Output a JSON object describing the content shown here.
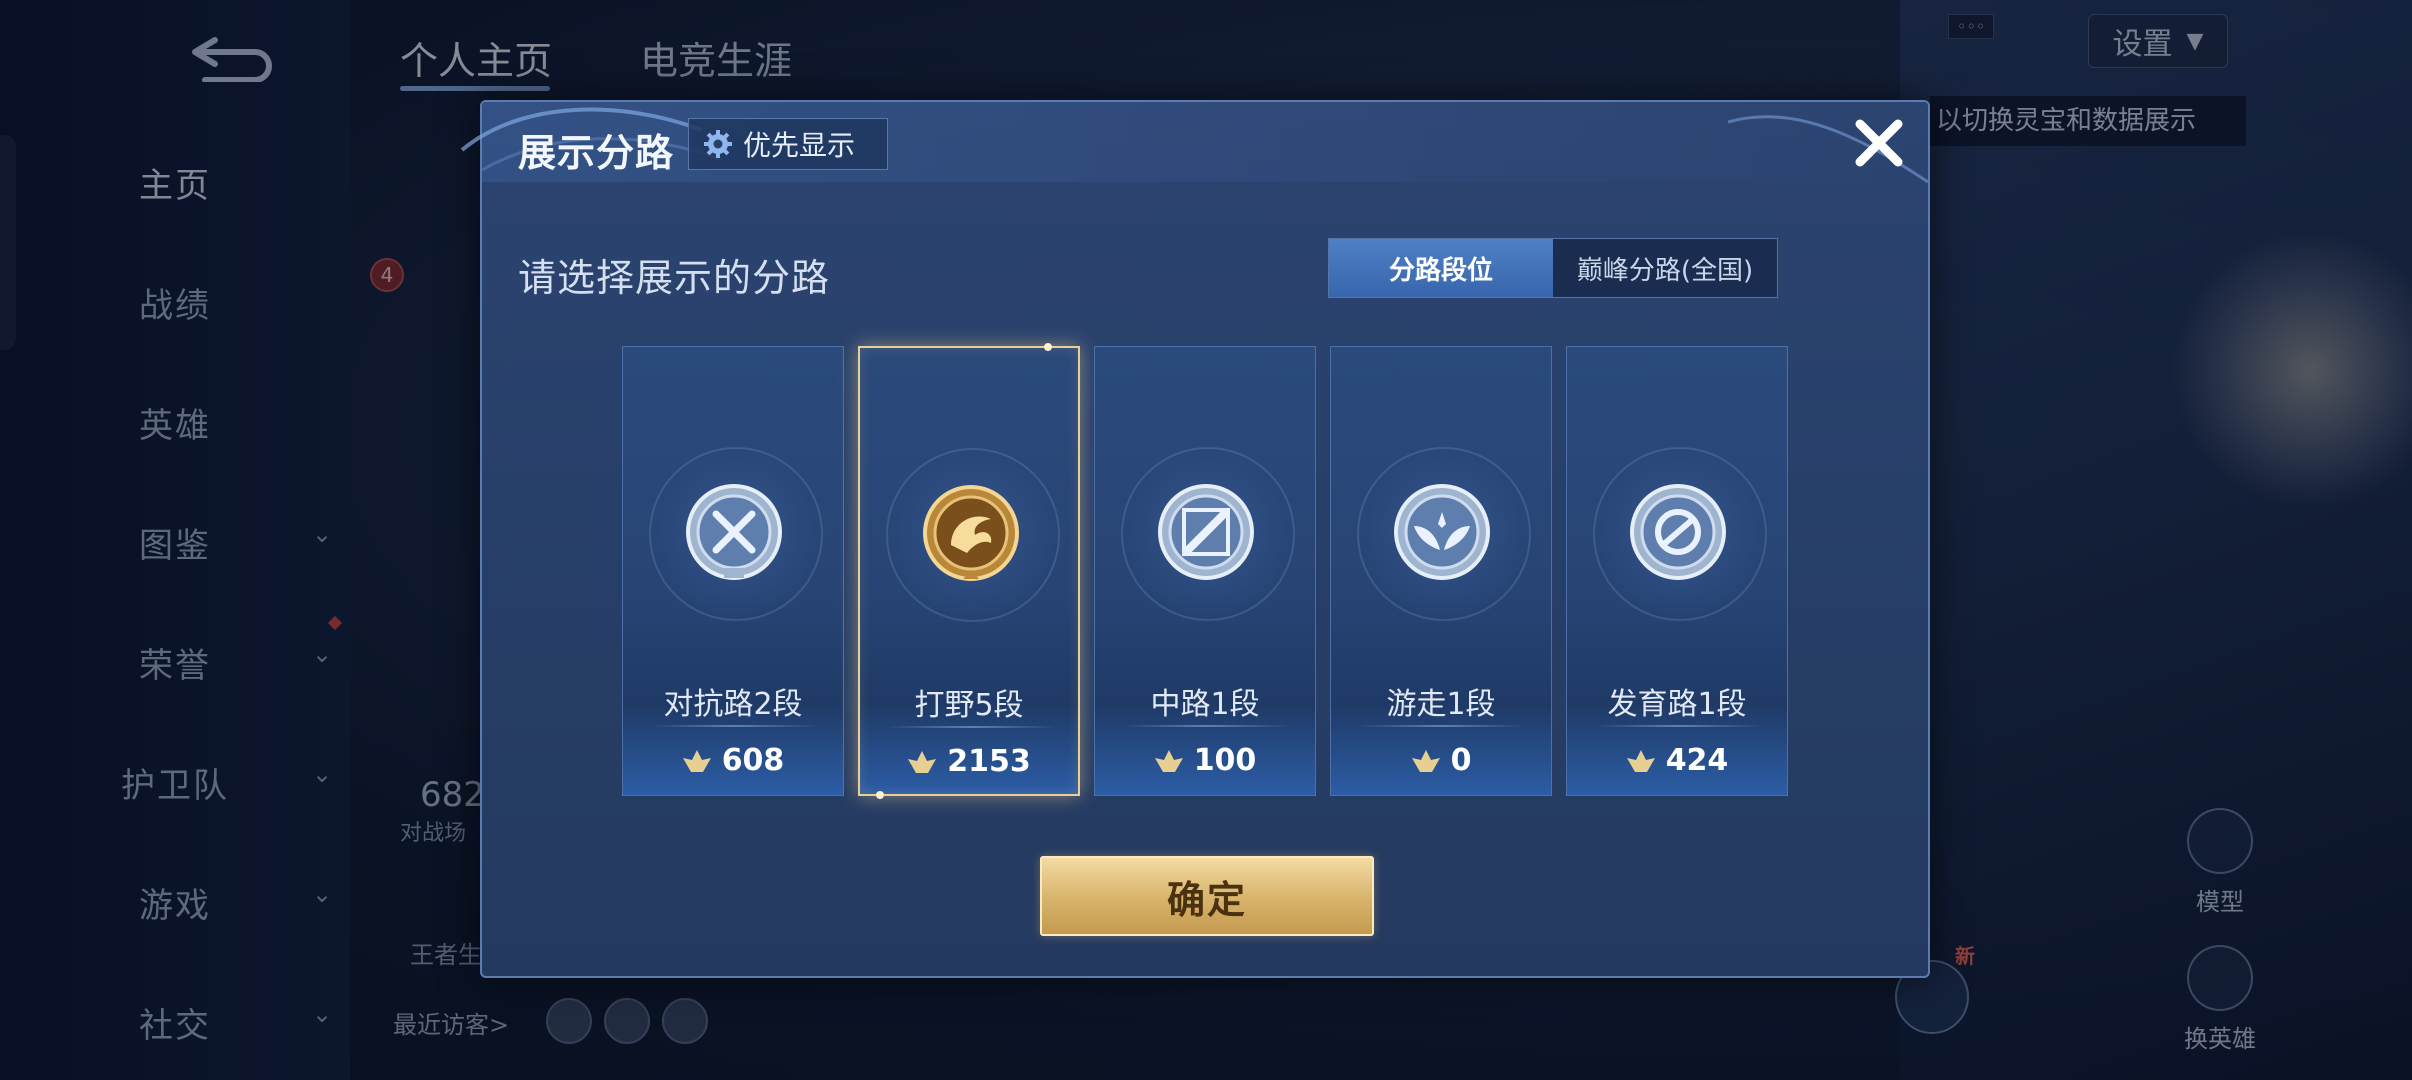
{
  "background": {
    "tabs": [
      {
        "label": "个人主页",
        "active": true
      },
      {
        "label": "电竞生涯",
        "active": false
      }
    ],
    "sidebar": {
      "items": [
        {
          "label": "主页",
          "active": true
        },
        {
          "label": "战绩"
        },
        {
          "label": "英雄"
        },
        {
          "label": "图鉴",
          "chevron": "⌄"
        },
        {
          "label": "荣誉",
          "chevron": "⌄"
        },
        {
          "label": "护卫队",
          "chevron": "⌄"
        },
        {
          "label": "游戏",
          "chevron": "⌄"
        },
        {
          "label": "社交",
          "chevron": "⌄"
        }
      ]
    },
    "settings_label": "设置",
    "hint_text": "以切换灵宝和数据展示",
    "badge_count": "4",
    "battle_count_partial": "682",
    "battle_label_partial": "对战场",
    "king_label_partial": "王者生",
    "recent_visitors": "最近访客>",
    "right_buttons": {
      "model": "模型",
      "switch_hero": "换英雄"
    },
    "new_badge": "新"
  },
  "dialog": {
    "title": "展示分路",
    "priority_button": {
      "label": "优先显示",
      "icon": "gear-icon"
    },
    "subtitle": "请选择展示的分路",
    "toggle": {
      "options": [
        "分路段位",
        "巅峰分路(全国)"
      ],
      "active_index": 0
    },
    "lanes": [
      {
        "rank": "对抗路2段",
        "score": "608",
        "emblem": "clash-lane-emblem",
        "selected": false
      },
      {
        "rank": "打野5段",
        "score": "2153",
        "emblem": "jungle-emblem",
        "selected": true
      },
      {
        "rank": "中路1段",
        "score": "100",
        "emblem": "mid-lane-emblem",
        "selected": false
      },
      {
        "rank": "游走1段",
        "score": "0",
        "emblem": "roam-emblem",
        "selected": false
      },
      {
        "rank": "发育路1段",
        "score": "424",
        "emblem": "farm-lane-emblem",
        "selected": false
      }
    ],
    "confirm_label": "确定",
    "colors": {
      "gold": "#d7b36b",
      "accent_blue": "#4f7fc4",
      "panel": "#27406a"
    }
  }
}
